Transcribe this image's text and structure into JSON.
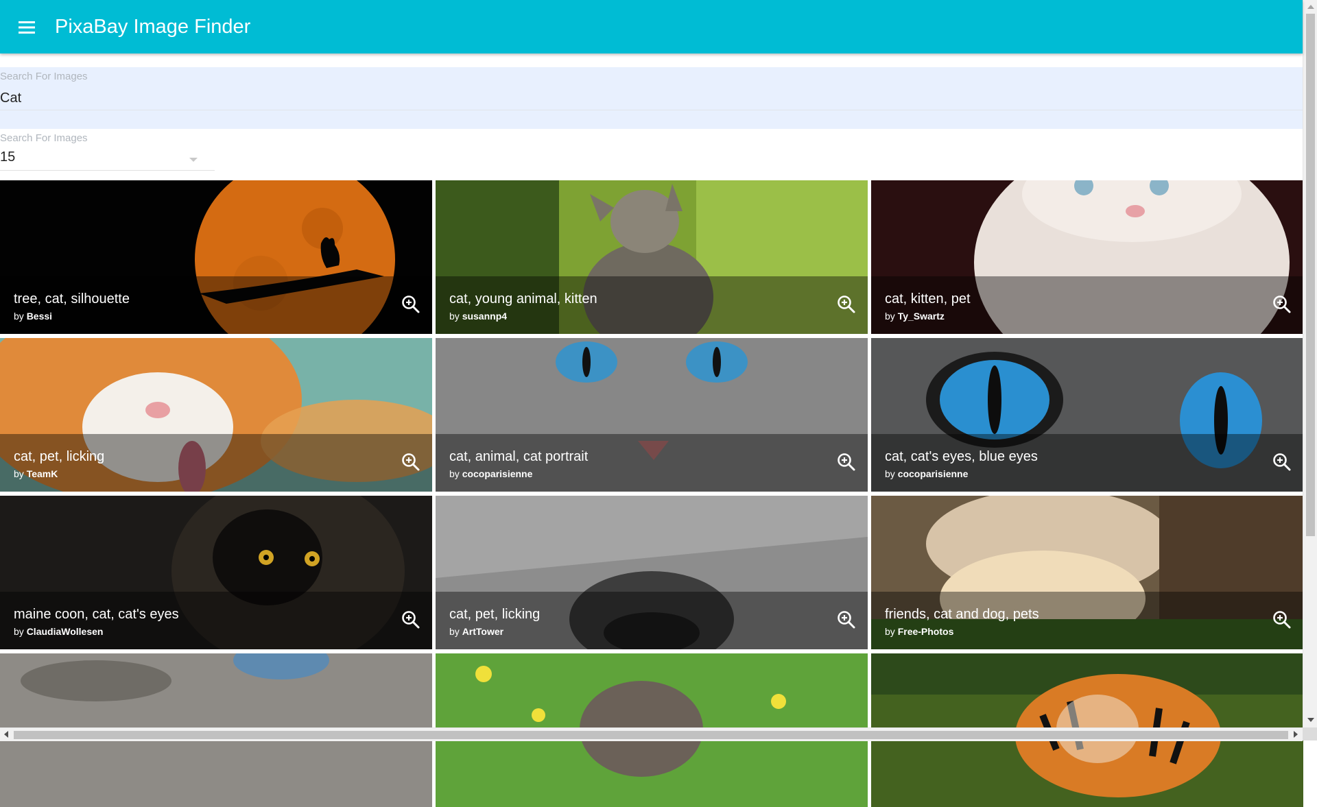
{
  "app": {
    "title": "PixaBay Image Finder",
    "menu_icon": "menu-icon",
    "accent_color": "#00bcd4"
  },
  "search": {
    "label": "Search For Images",
    "value": "Cat"
  },
  "amount": {
    "label": "Search For Images",
    "value": "15",
    "icon": "chevron-down-icon"
  },
  "results": [
    {
      "title": "tree, cat, silhouette",
      "by_prefix": "by",
      "author": "Bessi",
      "scene": "moon",
      "zoom_icon": "zoom-in-icon"
    },
    {
      "title": "cat, young animal, kitten",
      "by_prefix": "by",
      "author": "susannp4",
      "scene": "kitten-green",
      "zoom_icon": "zoom-in-icon"
    },
    {
      "title": "cat, kitten, pet",
      "by_prefix": "by",
      "author": "Ty_Swartz",
      "scene": "white-kitten",
      "zoom_icon": "zoom-in-icon"
    },
    {
      "title": "cat, pet, licking",
      "by_prefix": "by",
      "author": "TeamK",
      "scene": "orange-cat",
      "zoom_icon": "zoom-in-icon"
    },
    {
      "title": "cat, animal, cat portrait",
      "by_prefix": "by",
      "author": "cocoparisienne",
      "scene": "gray-portrait",
      "zoom_icon": "zoom-in-icon"
    },
    {
      "title": "cat, cat's eyes, blue eyes",
      "by_prefix": "by",
      "author": "cocoparisienne",
      "scene": "blue-eyes",
      "zoom_icon": "zoom-in-icon"
    },
    {
      "title": "maine coon, cat, cat's eyes",
      "by_prefix": "by",
      "author": "ClaudiaWollesen",
      "scene": "black-cat",
      "zoom_icon": "zoom-in-icon"
    },
    {
      "title": "cat, pet, licking",
      "by_prefix": "by",
      "author": "ArtTower",
      "scene": "tabby-closeup",
      "zoom_icon": "zoom-in-icon"
    },
    {
      "title": "friends, cat and dog, pets",
      "by_prefix": "by",
      "author": "Free-Photos",
      "scene": "cat-dog",
      "zoom_icon": "zoom-in-icon"
    },
    {
      "title": "",
      "by_prefix": "",
      "author": "",
      "scene": "gray-eye",
      "zoom_icon": "zoom-in-icon"
    },
    {
      "title": "",
      "by_prefix": "",
      "author": "",
      "scene": "kitten-flowers",
      "zoom_icon": "zoom-in-icon"
    },
    {
      "title": "",
      "by_prefix": "",
      "author": "",
      "scene": "tiger",
      "zoom_icon": "zoom-in-icon"
    }
  ]
}
